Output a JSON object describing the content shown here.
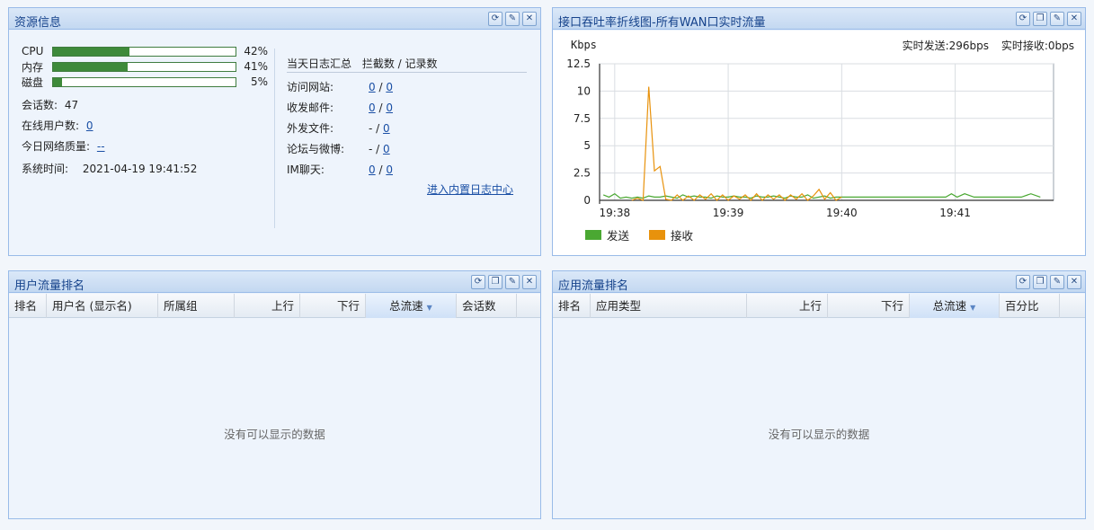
{
  "resource": {
    "title": "资源信息",
    "rows": [
      {
        "label": "CPU",
        "pct_text": "42%",
        "pct": 42
      },
      {
        "label": "内存",
        "pct_text": "41%",
        "pct": 41
      },
      {
        "label": "磁盘",
        "pct_text": "5%",
        "pct": 5
      }
    ],
    "sessions_label": "会话数:",
    "sessions_value": "47",
    "online_label": "在线用户数:",
    "online_value": "0",
    "quality_label": "今日网络质量:",
    "quality_value": "--",
    "time_label": "系统时间:",
    "time_value": "2021-04-19 19:41:52",
    "log_header_left": "当天日志汇总",
    "log_header_right": "拦截数 / 记录数",
    "logs": [
      {
        "label": "访问网站:",
        "blocked": "0",
        "sep": "/",
        "records": "0"
      },
      {
        "label": "收发邮件:",
        "blocked": "0",
        "sep": "/",
        "records": "0"
      },
      {
        "label": "外发文件:",
        "blocked": "-",
        "sep": "/",
        "records": "0"
      },
      {
        "label": "论坛与微博:",
        "blocked": "-",
        "sep": "/",
        "records": "0"
      },
      {
        "label": "IM聊天:",
        "blocked": "0",
        "sep": "/",
        "records": "0"
      }
    ],
    "log_center_link": "进入内置日志中心"
  },
  "throughput": {
    "title": "接口吞吐率折线图-所有WAN口实时流量",
    "unit": "Kbps",
    "realtime_send_label": "实时发送:",
    "realtime_send_value": "296bps",
    "realtime_recv_label": "实时接收:",
    "realtime_recv_value": "0bps",
    "legend_send": "发送",
    "legend_recv": "接收"
  },
  "chart_data": {
    "type": "line",
    "ylabel": "Kbps",
    "ylim": [
      0,
      12.5
    ],
    "yticks": [
      "12.5",
      "10",
      "7.5",
      "5",
      "2.5",
      "0"
    ],
    "ytick_values": [
      12.5,
      10,
      7.5,
      5,
      2.5,
      0
    ],
    "xticks": [
      "19:38",
      "19:39",
      "19:40",
      "19:41"
    ],
    "xtick_values": [
      0,
      60,
      120,
      180
    ],
    "xlim": [
      -8,
      232
    ],
    "grid": true,
    "legend": "bottom-left",
    "series": [
      {
        "name": "发送",
        "color": "#4aa832",
        "x": [
          -6,
          -3,
          0,
          3,
          6,
          9,
          12,
          15,
          18,
          21,
          24,
          27,
          30,
          33,
          36,
          39,
          42,
          45,
          48,
          51,
          54,
          57,
          60,
          63,
          66,
          69,
          72,
          75,
          78,
          81,
          84,
          87,
          90,
          93,
          96,
          99,
          102,
          105,
          108,
          111,
          114,
          117,
          120,
          125,
          130,
          135,
          140,
          145,
          150,
          155,
          160,
          165,
          170,
          175,
          178,
          181,
          185,
          190,
          195,
          200,
          205,
          210,
          215,
          220,
          225
        ],
        "values": [
          0.5,
          0.3,
          0.6,
          0.2,
          0.3,
          0.2,
          0.3,
          0.2,
          0.4,
          0.3,
          0.3,
          0.4,
          0.3,
          0.2,
          0.5,
          0.3,
          0.4,
          0.3,
          0.3,
          0.2,
          0.4,
          0.3,
          0.3,
          0.4,
          0.3,
          0.3,
          0.2,
          0.4,
          0.3,
          0.3,
          0.4,
          0.3,
          0.2,
          0.4,
          0.3,
          0.3,
          0.5,
          0.2,
          0.3,
          0.4,
          0.2,
          0.3,
          0.3,
          0.3,
          0.3,
          0.3,
          0.3,
          0.3,
          0.3,
          0.3,
          0.3,
          0.3,
          0.3,
          0.3,
          0.6,
          0.3,
          0.6,
          0.3,
          0.3,
          0.3,
          0.3,
          0.3,
          0.3,
          0.6,
          0.3
        ]
      },
      {
        "name": "接收",
        "color": "#e8920c",
        "x": [
          9,
          12,
          15,
          18,
          21,
          24,
          27,
          30,
          33,
          36,
          39,
          42,
          45,
          48,
          51,
          54,
          57,
          60,
          63,
          66,
          69,
          72,
          75,
          78,
          81,
          84,
          87,
          90,
          93,
          96,
          99,
          102,
          105,
          108,
          111,
          114,
          117,
          120
        ],
        "values": [
          0.0,
          0.2,
          0.0,
          10.4,
          2.7,
          3.1,
          0.1,
          0.0,
          0.5,
          0.0,
          0.4,
          0.0,
          0.5,
          0.1,
          0.6,
          0.0,
          0.5,
          0.0,
          0.4,
          0.1,
          0.5,
          0.0,
          0.6,
          0.0,
          0.5,
          0.1,
          0.5,
          0.0,
          0.5,
          0.1,
          0.6,
          0.0,
          0.4,
          1.0,
          0.1,
          0.7,
          0.0,
          0.3
        ]
      }
    ]
  },
  "user_rank": {
    "title": "用户流量排名",
    "columns": [
      "排名",
      "用户名 (显示名)",
      "所属组",
      "上行",
      "下行",
      "总流速",
      "会话数"
    ],
    "empty": "没有可以显示的数据"
  },
  "app_rank": {
    "title": "应用流量排名",
    "columns": [
      "排名",
      "应用类型",
      "上行",
      "下行",
      "总流速",
      "百分比"
    ],
    "empty": "没有可以显示的数据"
  }
}
